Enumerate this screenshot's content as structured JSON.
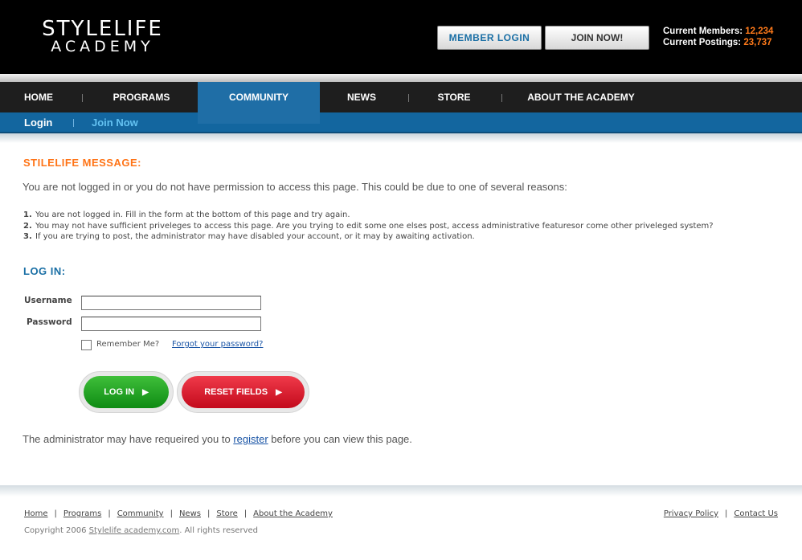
{
  "header": {
    "logo_line1": "STYLELIFE",
    "logo_line2": "ACADEMY",
    "member_login": "MEMBER  LOGIN",
    "join_now": "JOIN NOW!",
    "members_label": "Current Members:",
    "members_value": "12,234",
    "postings_label": "Current Postings:",
    "postings_value": "23,737"
  },
  "nav": {
    "items": [
      {
        "label": "HOME"
      },
      {
        "label": "PROGRAMS"
      },
      {
        "label": "COMMUNITY",
        "active": true
      },
      {
        "label": "NEWS"
      },
      {
        "label": "STORE"
      },
      {
        "label": "ABOUT THE ACADEMY"
      }
    ]
  },
  "subnav": {
    "login": "Login",
    "join": "Join Now"
  },
  "message": {
    "title": "STILELIFE MESSAGE:",
    "text": "You are not logged in or you do not have permission to access this page. This could be due to one of several reasons:",
    "reasons": [
      {
        "num": "1.",
        "text": "You are not logged in. Fill in the form at the bottom of this page and try again."
      },
      {
        "num": "2.",
        "text": "You may not have sufficient priveleges to access this page. Are you trying to edit some one elses post, access administrative featuresor come other priveleged system?"
      },
      {
        "num": "3.",
        "text": "If you are trying to post, the administrator may have disabled your account, or it may by awaiting activation."
      }
    ]
  },
  "login": {
    "title": "LOG IN:",
    "username_label": "Username",
    "password_label": "Password",
    "username_value": "",
    "password_value": "",
    "remember_label": "Remember Me?",
    "forgot_label": "Forgot your password?",
    "login_button": "LOG IN",
    "reset_button": "RESET FIELDS"
  },
  "admin_note": {
    "before": "The administrator may have requeired you to ",
    "link": "register",
    "after": " before you can view this page."
  },
  "footer": {
    "links": [
      "Home",
      "Programs",
      "Community",
      "News",
      "Store",
      "About the Academy"
    ],
    "right_links": [
      "Privacy Policy",
      "Contact Us"
    ],
    "copyright_prefix": "Copyright 2006 ",
    "copyright_link": "Stylelife academy.com",
    "copyright_suffix": ".  All rights reserved"
  }
}
